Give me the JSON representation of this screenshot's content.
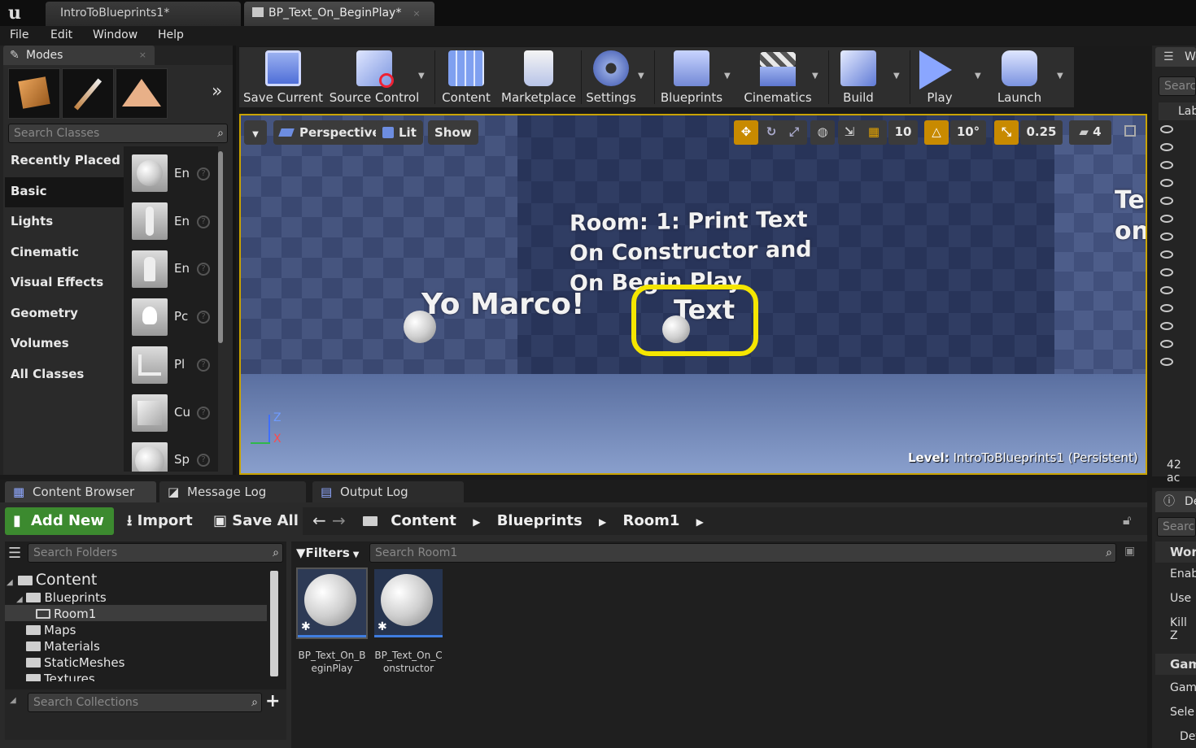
{
  "titlebar": {
    "tabs": [
      {
        "label": "IntroToBlueprints1*"
      },
      {
        "label": "BP_Text_On_BeginPlay*"
      }
    ]
  },
  "menu": [
    "File",
    "Edit",
    "Window",
    "Help"
  ],
  "modes": {
    "tab_label": "Modes",
    "search_placeholder": "Search Classes",
    "categories": [
      "Recently Placed",
      "Basic",
      "Lights",
      "Cinematic",
      "Visual Effects",
      "Geometry",
      "Volumes",
      "All Classes"
    ],
    "selected_category": "Basic",
    "class_items": [
      "En",
      "En",
      "En",
      "Pc",
      "Pl",
      "Cu",
      "Sp"
    ]
  },
  "toolbar": {
    "buttons": [
      {
        "label": "Save Current",
        "icon": "floppy-disk-icon"
      },
      {
        "label": "Source Control",
        "icon": "source-control-icon"
      },
      {
        "label": "Content",
        "icon": "content-grid-icon"
      },
      {
        "label": "Marketplace",
        "icon": "marketplace-bag-icon"
      },
      {
        "label": "Settings",
        "icon": "settings-gear-icon"
      },
      {
        "label": "Blueprints",
        "icon": "blueprints-icon"
      },
      {
        "label": "Cinematics",
        "icon": "clapperboard-icon"
      },
      {
        "label": "Build",
        "icon": "build-cubes-icon"
      },
      {
        "label": "Play",
        "icon": "play-icon"
      },
      {
        "label": "Launch",
        "icon": "launch-icon"
      }
    ]
  },
  "viewport": {
    "perspective": "Perspective",
    "lit": "Lit",
    "show": "Show",
    "grid_snap": "10",
    "rotation_snap": "10°",
    "scale_snap": "0.25",
    "camera_speed": "4",
    "room_text": [
      "Room: 1: Print Text",
      "On Constructor and",
      "On Begin Play"
    ],
    "yo_text": "Yo Marco!",
    "text_actor": "Text",
    "side_text": [
      "Te",
      "on"
    ],
    "level_label": "Level:",
    "level_name": "IntroToBlueprints1 (Persistent)",
    "axis_z": "Z",
    "axis_x": "X"
  },
  "outliner": {
    "tab_label": "Wo",
    "search_placeholder": "Searc",
    "column": "Lab",
    "actor_count": "42 ac"
  },
  "details": {
    "tab_label": "De",
    "search_placeholder": "Searc",
    "sections": [
      "World",
      "Enab",
      "Use",
      "Kill Z",
      "Gam",
      "Gam",
      "Sele",
      "Def"
    ]
  },
  "content_browser": {
    "tabs": [
      "Content Browser",
      "Message Log",
      "Output Log"
    ],
    "add_new": "Add New",
    "import": "Import",
    "save_all": "Save All",
    "breadcrumb": [
      "Content",
      "Blueprints",
      "Room1"
    ],
    "search_folders": "Search Folders",
    "filters": "Filters",
    "search_assets": "Search Room1",
    "search_collections": "Search Collections",
    "tree": [
      {
        "label": "Content",
        "level": 0
      },
      {
        "label": "Blueprints",
        "level": 1
      },
      {
        "label": "Room1",
        "level": 2,
        "selected": true
      },
      {
        "label": "Maps",
        "level": 1
      },
      {
        "label": "Materials",
        "level": 1
      },
      {
        "label": "StaticMeshes",
        "level": 1
      },
      {
        "label": "Textures",
        "level": 1
      }
    ],
    "assets": [
      {
        "name": "BP_Text_On_BeginPlay"
      },
      {
        "name": "BP_Text_On_Constructor"
      }
    ]
  },
  "colors": {
    "highlight": "#f5e600",
    "add_new_green": "#3c8a2f",
    "viewport_border": "#c9a300"
  }
}
